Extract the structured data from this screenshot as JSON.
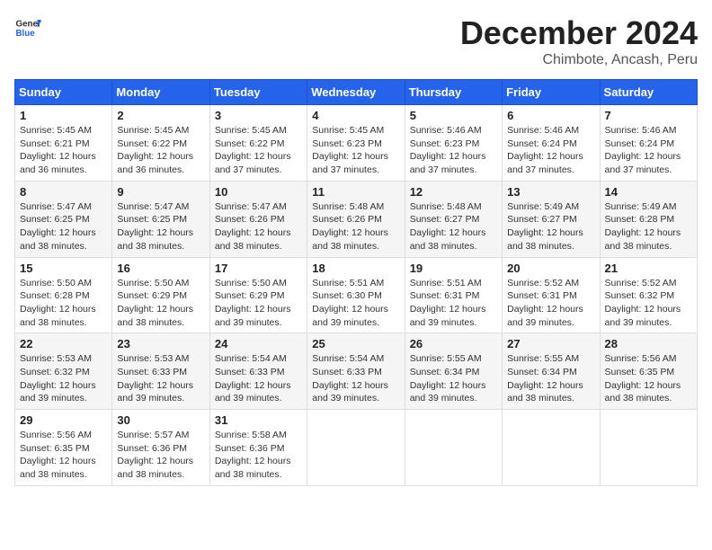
{
  "header": {
    "logo_general": "General",
    "logo_blue": "Blue",
    "month_title": "December 2024",
    "location": "Chimbote, Ancash, Peru"
  },
  "weekdays": [
    "Sunday",
    "Monday",
    "Tuesday",
    "Wednesday",
    "Thursday",
    "Friday",
    "Saturday"
  ],
  "weeks": [
    [
      {
        "day": "1",
        "lines": [
          "Sunrise: 5:45 AM",
          "Sunset: 6:21 PM",
          "Daylight: 12 hours",
          "and 36 minutes."
        ]
      },
      {
        "day": "2",
        "lines": [
          "Sunrise: 5:45 AM",
          "Sunset: 6:22 PM",
          "Daylight: 12 hours",
          "and 36 minutes."
        ]
      },
      {
        "day": "3",
        "lines": [
          "Sunrise: 5:45 AM",
          "Sunset: 6:22 PM",
          "Daylight: 12 hours",
          "and 37 minutes."
        ]
      },
      {
        "day": "4",
        "lines": [
          "Sunrise: 5:45 AM",
          "Sunset: 6:23 PM",
          "Daylight: 12 hours",
          "and 37 minutes."
        ]
      },
      {
        "day": "5",
        "lines": [
          "Sunrise: 5:46 AM",
          "Sunset: 6:23 PM",
          "Daylight: 12 hours",
          "and 37 minutes."
        ]
      },
      {
        "day": "6",
        "lines": [
          "Sunrise: 5:46 AM",
          "Sunset: 6:24 PM",
          "Daylight: 12 hours",
          "and 37 minutes."
        ]
      },
      {
        "day": "7",
        "lines": [
          "Sunrise: 5:46 AM",
          "Sunset: 6:24 PM",
          "Daylight: 12 hours",
          "and 37 minutes."
        ]
      }
    ],
    [
      {
        "day": "8",
        "lines": [
          "Sunrise: 5:47 AM",
          "Sunset: 6:25 PM",
          "Daylight: 12 hours",
          "and 38 minutes."
        ]
      },
      {
        "day": "9",
        "lines": [
          "Sunrise: 5:47 AM",
          "Sunset: 6:25 PM",
          "Daylight: 12 hours",
          "and 38 minutes."
        ]
      },
      {
        "day": "10",
        "lines": [
          "Sunrise: 5:47 AM",
          "Sunset: 6:26 PM",
          "Daylight: 12 hours",
          "and 38 minutes."
        ]
      },
      {
        "day": "11",
        "lines": [
          "Sunrise: 5:48 AM",
          "Sunset: 6:26 PM",
          "Daylight: 12 hours",
          "and 38 minutes."
        ]
      },
      {
        "day": "12",
        "lines": [
          "Sunrise: 5:48 AM",
          "Sunset: 6:27 PM",
          "Daylight: 12 hours",
          "and 38 minutes."
        ]
      },
      {
        "day": "13",
        "lines": [
          "Sunrise: 5:49 AM",
          "Sunset: 6:27 PM",
          "Daylight: 12 hours",
          "and 38 minutes."
        ]
      },
      {
        "day": "14",
        "lines": [
          "Sunrise: 5:49 AM",
          "Sunset: 6:28 PM",
          "Daylight: 12 hours",
          "and 38 minutes."
        ]
      }
    ],
    [
      {
        "day": "15",
        "lines": [
          "Sunrise: 5:50 AM",
          "Sunset: 6:28 PM",
          "Daylight: 12 hours",
          "and 38 minutes."
        ]
      },
      {
        "day": "16",
        "lines": [
          "Sunrise: 5:50 AM",
          "Sunset: 6:29 PM",
          "Daylight: 12 hours",
          "and 38 minutes."
        ]
      },
      {
        "day": "17",
        "lines": [
          "Sunrise: 5:50 AM",
          "Sunset: 6:29 PM",
          "Daylight: 12 hours",
          "and 39 minutes."
        ]
      },
      {
        "day": "18",
        "lines": [
          "Sunrise: 5:51 AM",
          "Sunset: 6:30 PM",
          "Daylight: 12 hours",
          "and 39 minutes."
        ]
      },
      {
        "day": "19",
        "lines": [
          "Sunrise: 5:51 AM",
          "Sunset: 6:31 PM",
          "Daylight: 12 hours",
          "and 39 minutes."
        ]
      },
      {
        "day": "20",
        "lines": [
          "Sunrise: 5:52 AM",
          "Sunset: 6:31 PM",
          "Daylight: 12 hours",
          "and 39 minutes."
        ]
      },
      {
        "day": "21",
        "lines": [
          "Sunrise: 5:52 AM",
          "Sunset: 6:32 PM",
          "Daylight: 12 hours",
          "and 39 minutes."
        ]
      }
    ],
    [
      {
        "day": "22",
        "lines": [
          "Sunrise: 5:53 AM",
          "Sunset: 6:32 PM",
          "Daylight: 12 hours",
          "and 39 minutes."
        ]
      },
      {
        "day": "23",
        "lines": [
          "Sunrise: 5:53 AM",
          "Sunset: 6:33 PM",
          "Daylight: 12 hours",
          "and 39 minutes."
        ]
      },
      {
        "day": "24",
        "lines": [
          "Sunrise: 5:54 AM",
          "Sunset: 6:33 PM",
          "Daylight: 12 hours",
          "and 39 minutes."
        ]
      },
      {
        "day": "25",
        "lines": [
          "Sunrise: 5:54 AM",
          "Sunset: 6:33 PM",
          "Daylight: 12 hours",
          "and 39 minutes."
        ]
      },
      {
        "day": "26",
        "lines": [
          "Sunrise: 5:55 AM",
          "Sunset: 6:34 PM",
          "Daylight: 12 hours",
          "and 39 minutes."
        ]
      },
      {
        "day": "27",
        "lines": [
          "Sunrise: 5:55 AM",
          "Sunset: 6:34 PM",
          "Daylight: 12 hours",
          "and 38 minutes."
        ]
      },
      {
        "day": "28",
        "lines": [
          "Sunrise: 5:56 AM",
          "Sunset: 6:35 PM",
          "Daylight: 12 hours",
          "and 38 minutes."
        ]
      }
    ],
    [
      {
        "day": "29",
        "lines": [
          "Sunrise: 5:56 AM",
          "Sunset: 6:35 PM",
          "Daylight: 12 hours",
          "and 38 minutes."
        ]
      },
      {
        "day": "30",
        "lines": [
          "Sunrise: 5:57 AM",
          "Sunset: 6:36 PM",
          "Daylight: 12 hours",
          "and 38 minutes."
        ]
      },
      {
        "day": "31",
        "lines": [
          "Sunrise: 5:58 AM",
          "Sunset: 6:36 PM",
          "Daylight: 12 hours",
          "and 38 minutes."
        ]
      },
      null,
      null,
      null,
      null
    ]
  ]
}
